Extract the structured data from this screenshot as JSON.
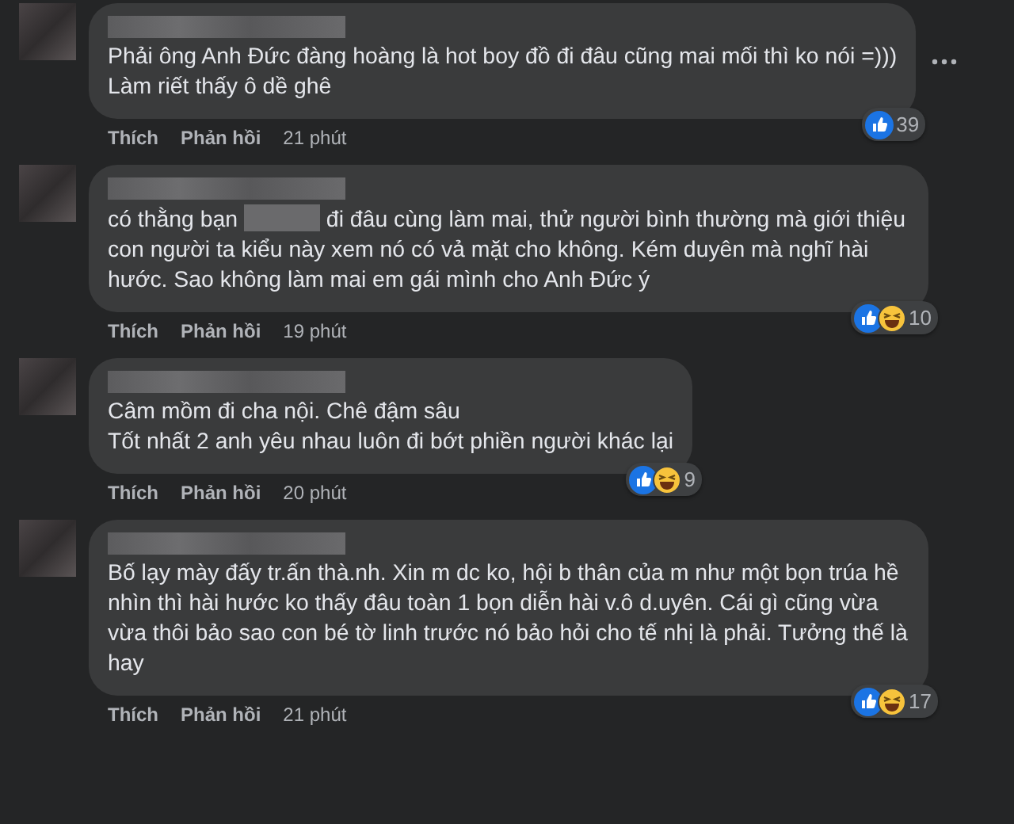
{
  "comments": [
    {
      "paragraphs": [
        [
          {
            "kind": "text",
            "text": "Phải ông Anh Đức đàng hoàng là hot boy đồ đi đâu cũng mai mối thì ko nói =)))"
          }
        ],
        [
          {
            "kind": "text",
            "text": "Làm riết thấy ô dề ghê"
          }
        ]
      ],
      "more_menu": true,
      "reactions": [
        {
          "kind": "like"
        }
      ],
      "reaction_count": "39",
      "actions": [
        "Thích",
        "Phản hồi"
      ],
      "time": "21 phút"
    },
    {
      "paragraphs": [
        [
          {
            "kind": "text",
            "text": "có thằng bạn "
          },
          {
            "kind": "redaction"
          },
          {
            "kind": "text",
            "text": " đi đâu cùng làm mai, thử người bình thường mà giới thiệu con người ta kiểu này xem nó có vả mặt cho không. Kém duyên mà nghĩ hài hước. Sao không làm mai em gái mình cho Anh Đức ý"
          }
        ]
      ],
      "more_menu": false,
      "reactions": [
        {
          "kind": "like"
        },
        {
          "kind": "haha"
        }
      ],
      "reaction_count": "10",
      "actions": [
        "Thích",
        "Phản hồi"
      ],
      "time": "19 phút"
    },
    {
      "paragraphs": [
        [
          {
            "kind": "text",
            "text": "Câm mồm đi cha nội. Chê đậm sâu"
          }
        ],
        [
          {
            "kind": "text",
            "text": "Tốt nhất 2 anh yêu nhau luôn đi bớt phiền người khác lại"
          }
        ]
      ],
      "more_menu": false,
      "reactions": [
        {
          "kind": "like"
        },
        {
          "kind": "haha"
        }
      ],
      "reaction_count": "9",
      "actions": [
        "Thích",
        "Phản hồi"
      ],
      "time": "20 phút"
    },
    {
      "paragraphs": [
        [
          {
            "kind": "text",
            "text": "Bố lạy mày đấy tr.ấn thà.nh. Xin m dc ko, hội b thân của m như một bọn trúa hề nhìn thì hài hước ko thấy đâu toàn 1 bọn diễn hài v.ô d.uyên. Cái gì cũng vừa vừa thôi bảo sao con bé tờ linh trước nó bảo hỏi cho tế nhị là phải. Tưởng thế là hay"
          }
        ]
      ],
      "more_menu": false,
      "reactions": [
        {
          "kind": "like"
        },
        {
          "kind": "haha"
        }
      ],
      "reaction_count": "17",
      "actions": [
        "Thích",
        "Phản hồi"
      ],
      "time": "21 phút"
    }
  ]
}
